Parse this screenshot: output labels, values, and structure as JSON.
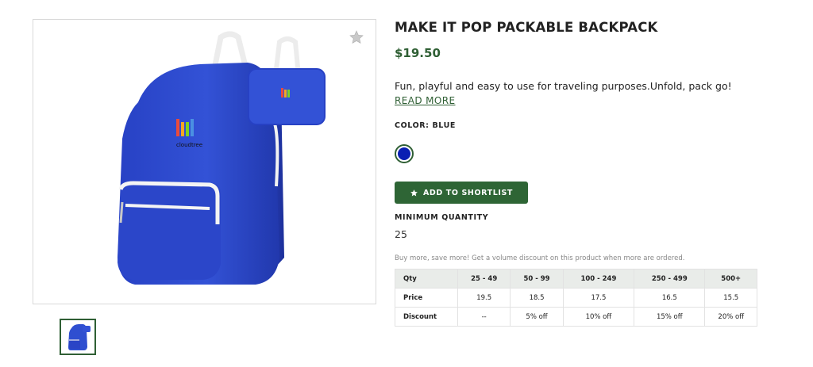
{
  "product": {
    "title": "MAKE IT POP PACKABLE BACKPACK",
    "price": "$19.50",
    "description": "Fun, playful and easy to use for traveling purposes.Unfold, pack go!",
    "read_more": "READ MORE",
    "color_label": "COLOR: BLUE",
    "color_swatch": "#0a1fb3",
    "add_button": "ADD TO SHORTLIST",
    "min_qty_label": "MINIMUM QUANTITY",
    "min_qty_value": "25",
    "image_logo_text": "cloudtree"
  },
  "volume": {
    "note": "Buy more, save more! Get a volume discount on this product when more are ordered.",
    "headers": [
      "Qty",
      "25 - 49",
      "50 - 99",
      "100 - 249",
      "250 - 499",
      "500+"
    ],
    "rows": [
      [
        "Price",
        "19.5",
        "18.5",
        "17.5",
        "16.5",
        "15.5"
      ],
      [
        "Discount",
        "--",
        "5% off",
        "10% off",
        "15% off",
        "20% off"
      ]
    ]
  },
  "icons": {
    "favorite": "star-icon",
    "add": "star-icon"
  },
  "colors": {
    "accent": "#2e6535",
    "bag": "#2f4fd0",
    "table_header": "#e9ece9"
  }
}
